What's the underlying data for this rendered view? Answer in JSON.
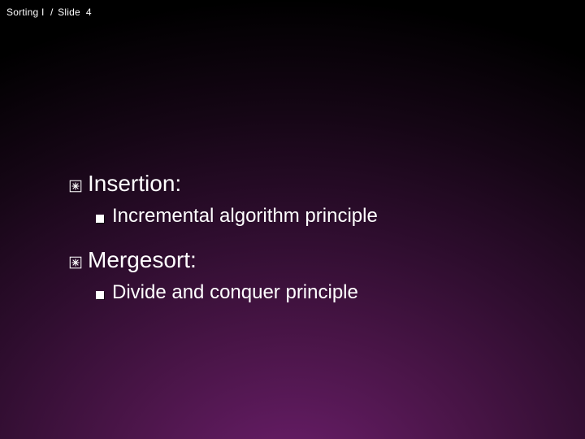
{
  "header": {
    "course": "Sorting I",
    "separator": "/",
    "slide_label": "Slide",
    "slide_number": "4"
  },
  "content": {
    "items": [
      {
        "title": "Insertion:",
        "sub": "Incremental algorithm principle"
      },
      {
        "title": "Mergesort:",
        "sub": "Divide and conquer principle"
      }
    ]
  }
}
